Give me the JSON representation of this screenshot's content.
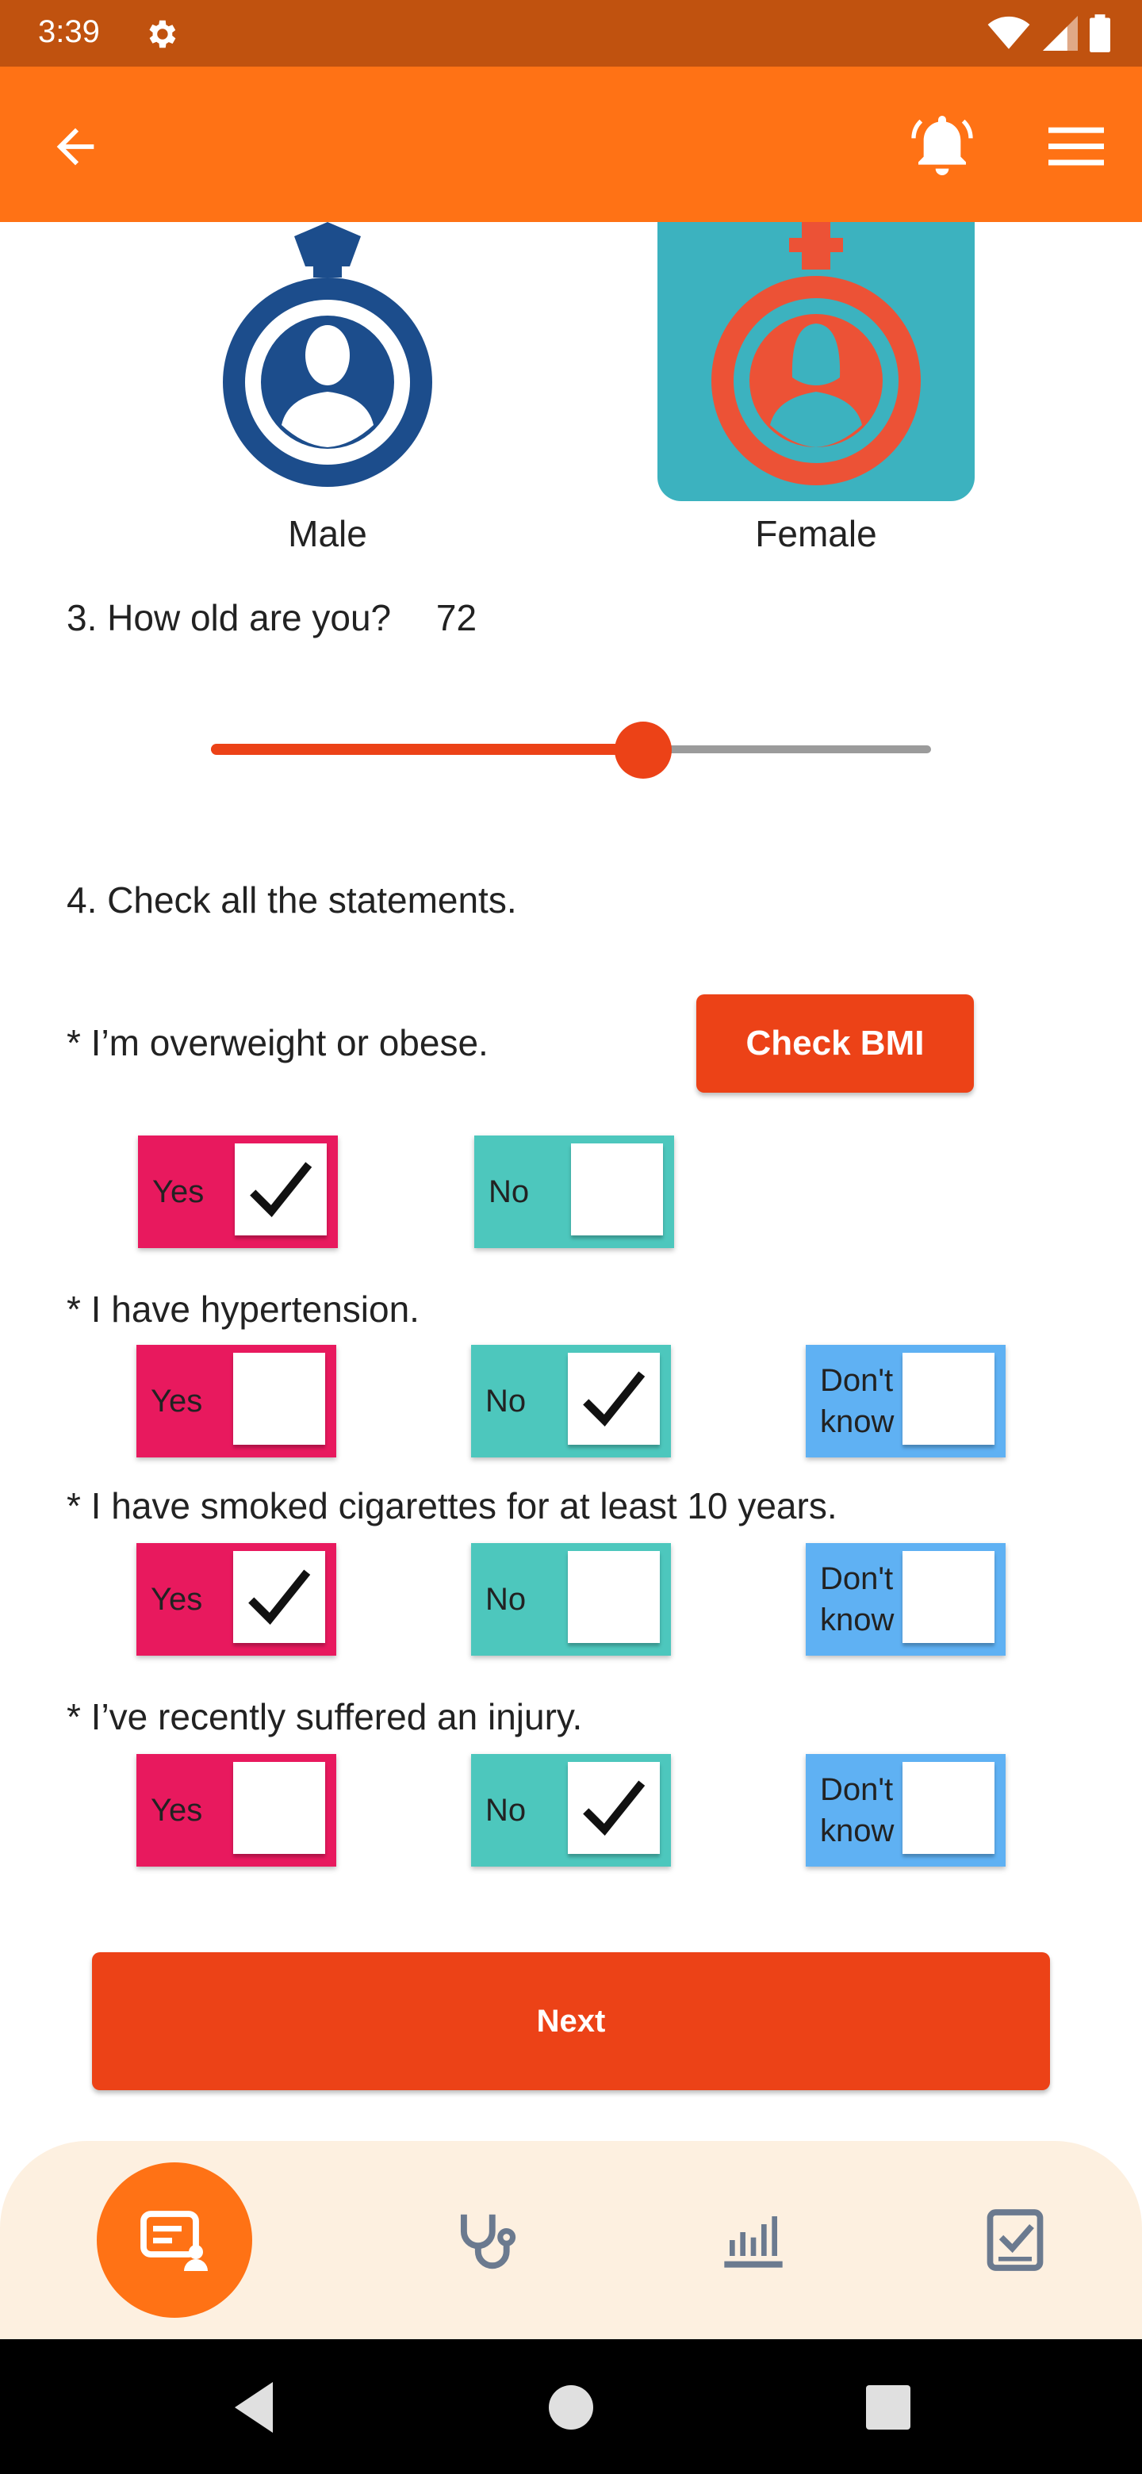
{
  "status_bar": {
    "time": "3:39"
  },
  "colors": {
    "status": "#c0520f",
    "appbar": "#ff7215",
    "accent": "#ec4217",
    "yes": "#e8195e",
    "no": "#4dc7bd",
    "dont_know": "#5fb1f3",
    "female_tile": "#3cb2bf",
    "male_icon": "#1c4d8c",
    "female_icon": "#ec5236"
  },
  "gender": {
    "male_label": "Male",
    "female_label": "Female",
    "selected": "female"
  },
  "age": {
    "question": "3. How old are you?",
    "value": "72",
    "slider_fraction": 0.6
  },
  "statements": {
    "title": "4. Check all the statements.",
    "check_bmi_label": "Check BMI",
    "yes_label": "Yes",
    "no_label": "No",
    "dont_know_line1": "Don't",
    "dont_know_line2": "know",
    "items": [
      {
        "text": "* I’m overweight or obese.",
        "yes": true,
        "no": false
      },
      {
        "text": "* I have hypertension.",
        "yes": false,
        "no": true,
        "dont_know": false
      },
      {
        "text": "* I have smoked cigarettes for at least 10 years.",
        "yes": true,
        "no": false,
        "dont_know": false
      },
      {
        "text": "* I’ve recently suffered an injury.",
        "yes": false,
        "no": true,
        "dont_know": false
      }
    ]
  },
  "next_label": "Next",
  "bottom_nav": {
    "items": [
      {
        "icon": "questionnaire-icon",
        "active": true
      },
      {
        "icon": "stethoscope-icon",
        "active": false
      },
      {
        "icon": "chart-icon",
        "active": false
      },
      {
        "icon": "checklist-icon",
        "active": false
      }
    ]
  }
}
